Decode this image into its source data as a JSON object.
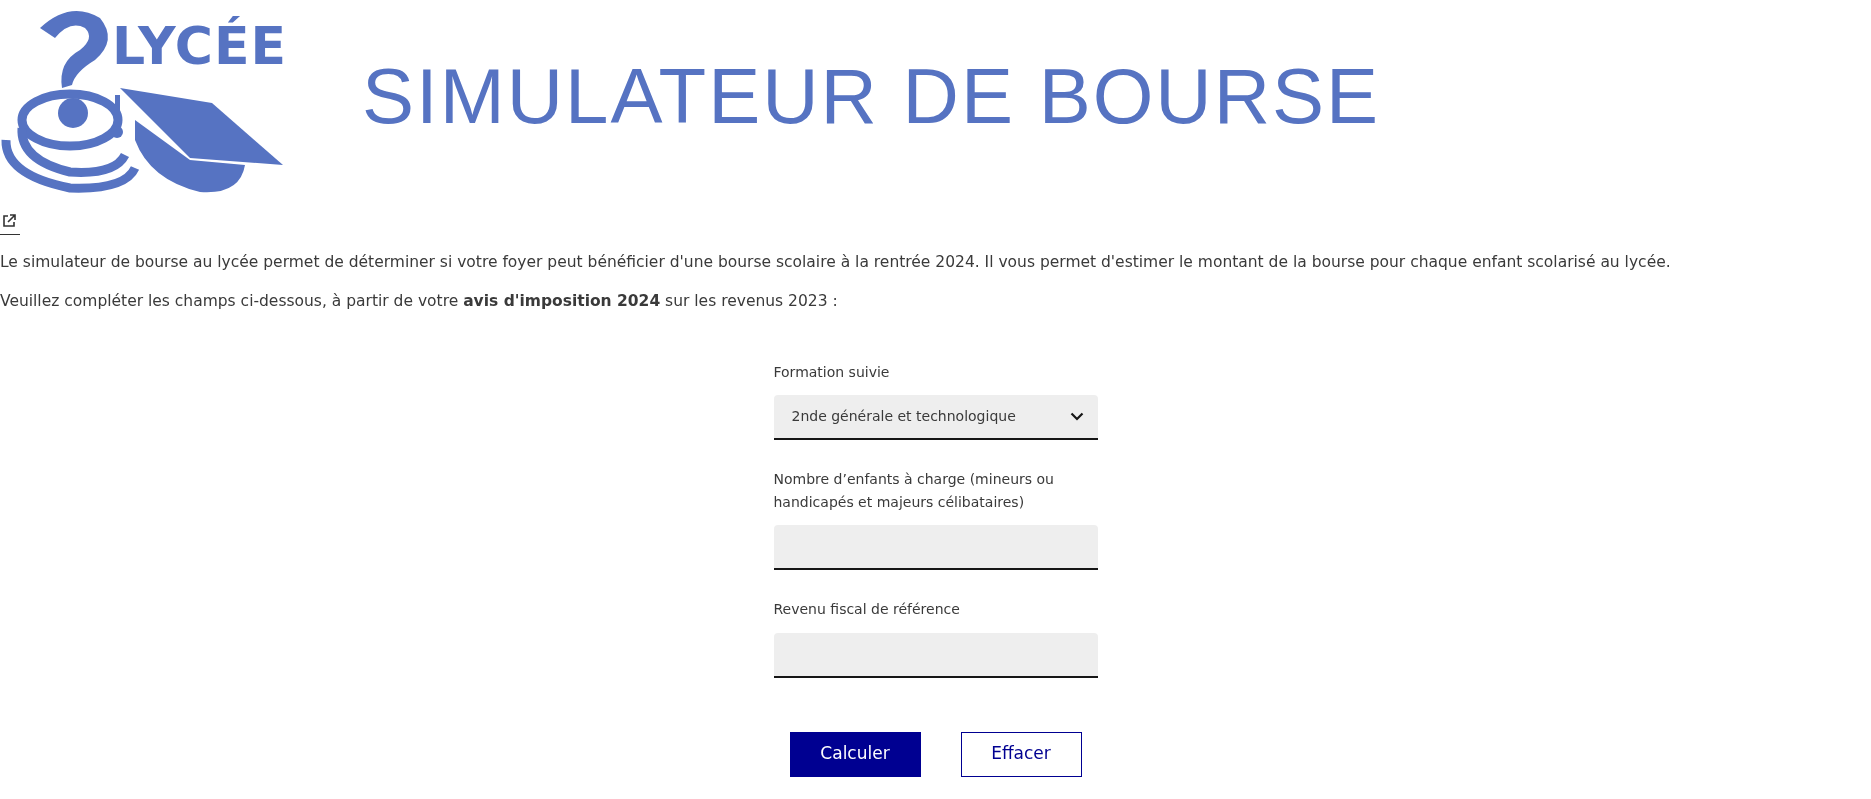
{
  "header": {
    "logo_text": "LYCÉE",
    "title": "SIMULATEUR DE BOURSE"
  },
  "intro": [
    "Le simulateur de bourse au lycée permet de déterminer si votre foyer peut bénéficier d'une bourse scolaire à la rentrée 2024. Il vous permet d'estimer le montant de la bourse pour chaque enfant scolarisé au lycée.",
    "Veuillez compléter les champs ci-dessous, à partir de votre **avis d'imposition 2024** sur les revenus 2023 :"
  ],
  "form": {
    "fields": [
      {
        "kind": "select",
        "label": "Formation suivie",
        "value": "2nde générale et technologique"
      },
      {
        "kind": "input",
        "label": "Nombre d’enfants à charge (mineurs ou handicapés et majeurs célibataires)"
      },
      {
        "kind": "input",
        "label": "Revenu fiscal de référence"
      }
    ],
    "buttons": [
      {
        "kind": "primary",
        "label": "Calculer"
      },
      {
        "kind": "secondary",
        "label": "Effacer"
      }
    ]
  }
}
